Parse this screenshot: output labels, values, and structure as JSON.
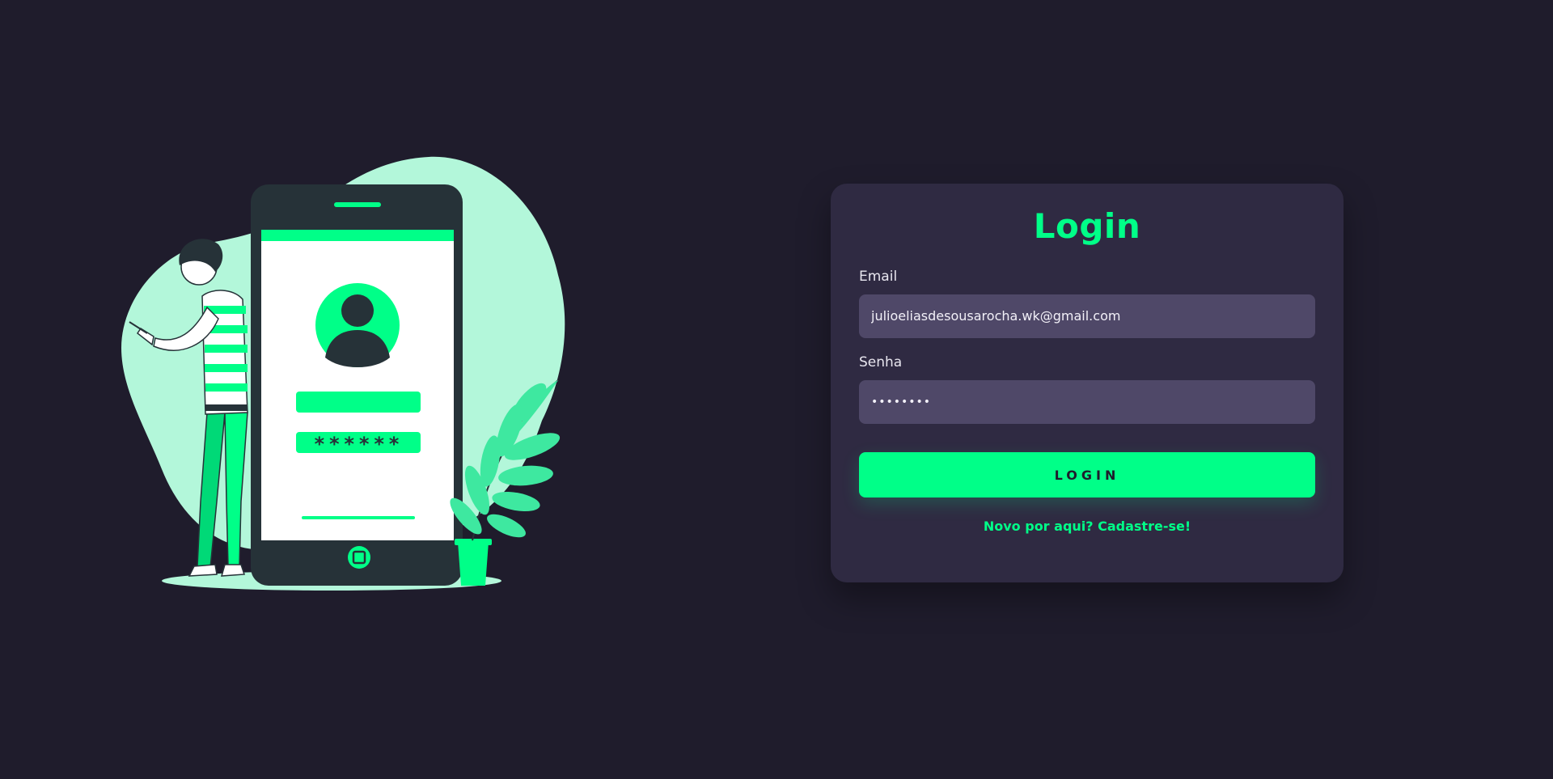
{
  "login_card": {
    "title": "Login",
    "email_label": "Email",
    "email_value": "julioeliasdesousarocha.wk@gmail.com",
    "password_label": "Senha",
    "password_value": "••••••••",
    "submit_label": "LOGIN",
    "signup_link": "Novo por aqui? Cadastre-se!"
  },
  "illustration": {
    "password_mask": "******"
  },
  "colors": {
    "background": "#1f1c2c",
    "card": "#2f2a42",
    "input": "#4f4868",
    "accent": "#00ff88",
    "blob": "#b3f7da",
    "dark": "#263238"
  }
}
